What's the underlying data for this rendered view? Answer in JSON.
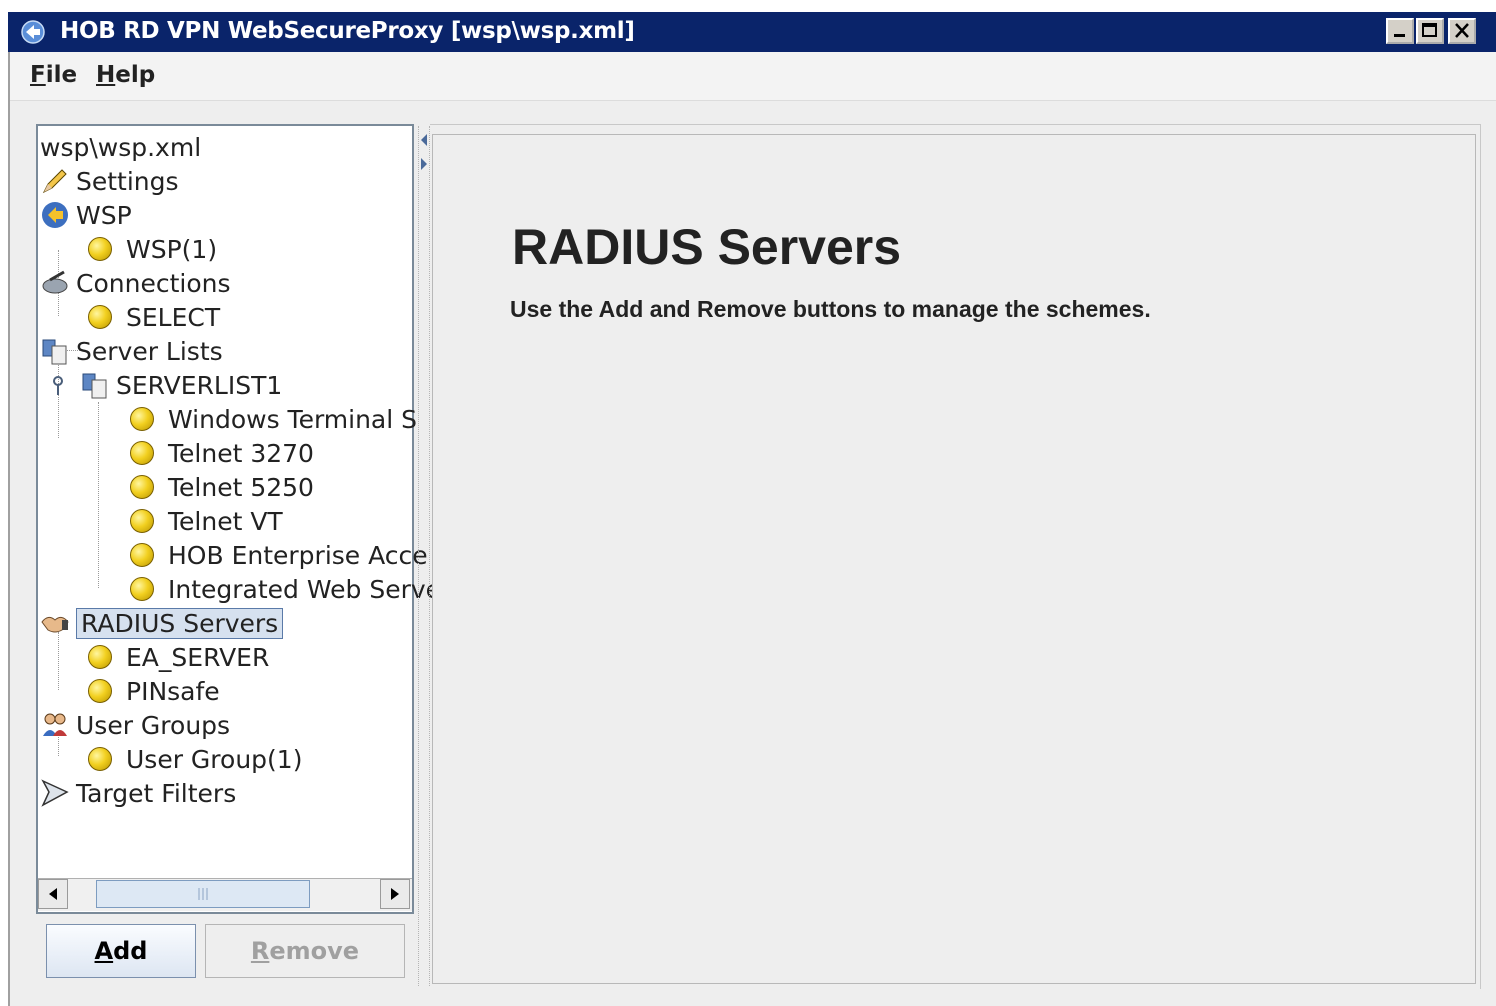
{
  "window": {
    "title": "HOB RD VPN WebSecureProxy [wsp\\wsp.xml]",
    "title_bar_color": "#0a246a",
    "controls": [
      "minimize-icon",
      "maximize-icon",
      "close-icon"
    ]
  },
  "menubar": {
    "items": [
      {
        "label": "File",
        "mnemonic": "F",
        "rest": "ile"
      },
      {
        "label": "Help",
        "mnemonic": "H",
        "rest": "elp"
      }
    ]
  },
  "tree": {
    "root": "wsp\\wsp.xml",
    "nodes": [
      {
        "label": "Settings",
        "icon": "pencil-icon"
      },
      {
        "label": "WSP",
        "icon": "wsp-globe-icon"
      },
      {
        "label": "WSP(1)",
        "icon": "yellow-bulb-icon"
      },
      {
        "label": "Connections",
        "icon": "connections-icon"
      },
      {
        "label": "SELECT",
        "icon": "yellow-bulb-icon"
      },
      {
        "label": "Server Lists",
        "icon": "server-list-icon"
      },
      {
        "label": "SERVERLIST1",
        "icon": "server-list-icon"
      },
      {
        "label": "Windows Terminal S",
        "icon": "yellow-bulb-icon"
      },
      {
        "label": "Telnet 3270",
        "icon": "yellow-bulb-icon"
      },
      {
        "label": "Telnet 5250",
        "icon": "yellow-bulb-icon"
      },
      {
        "label": "Telnet VT",
        "icon": "yellow-bulb-icon"
      },
      {
        "label": "HOB Enterprise Acce",
        "icon": "yellow-bulb-icon"
      },
      {
        "label": "Integrated Web Serve",
        "icon": "yellow-bulb-icon"
      },
      {
        "label": "RADIUS Servers",
        "icon": "radius-handshake-icon",
        "selected": true
      },
      {
        "label": "EA_SERVER",
        "icon": "yellow-bulb-icon"
      },
      {
        "label": "PINsafe",
        "icon": "yellow-bulb-icon"
      },
      {
        "label": "User Groups",
        "icon": "user-groups-icon"
      },
      {
        "label": "User Group(1)",
        "icon": "yellow-bulb-icon"
      },
      {
        "label": "Target Filters",
        "icon": "target-filter-icon"
      }
    ]
  },
  "buttons": {
    "add": {
      "label": "Add",
      "mnemonic": "A",
      "rest": "dd"
    },
    "remove": {
      "label": "Remove",
      "mnemonic": "R",
      "rest": "emove",
      "enabled": false
    }
  },
  "content": {
    "heading": "RADIUS Servers",
    "description": "Use the Add and Remove buttons to manage the schemes."
  }
}
